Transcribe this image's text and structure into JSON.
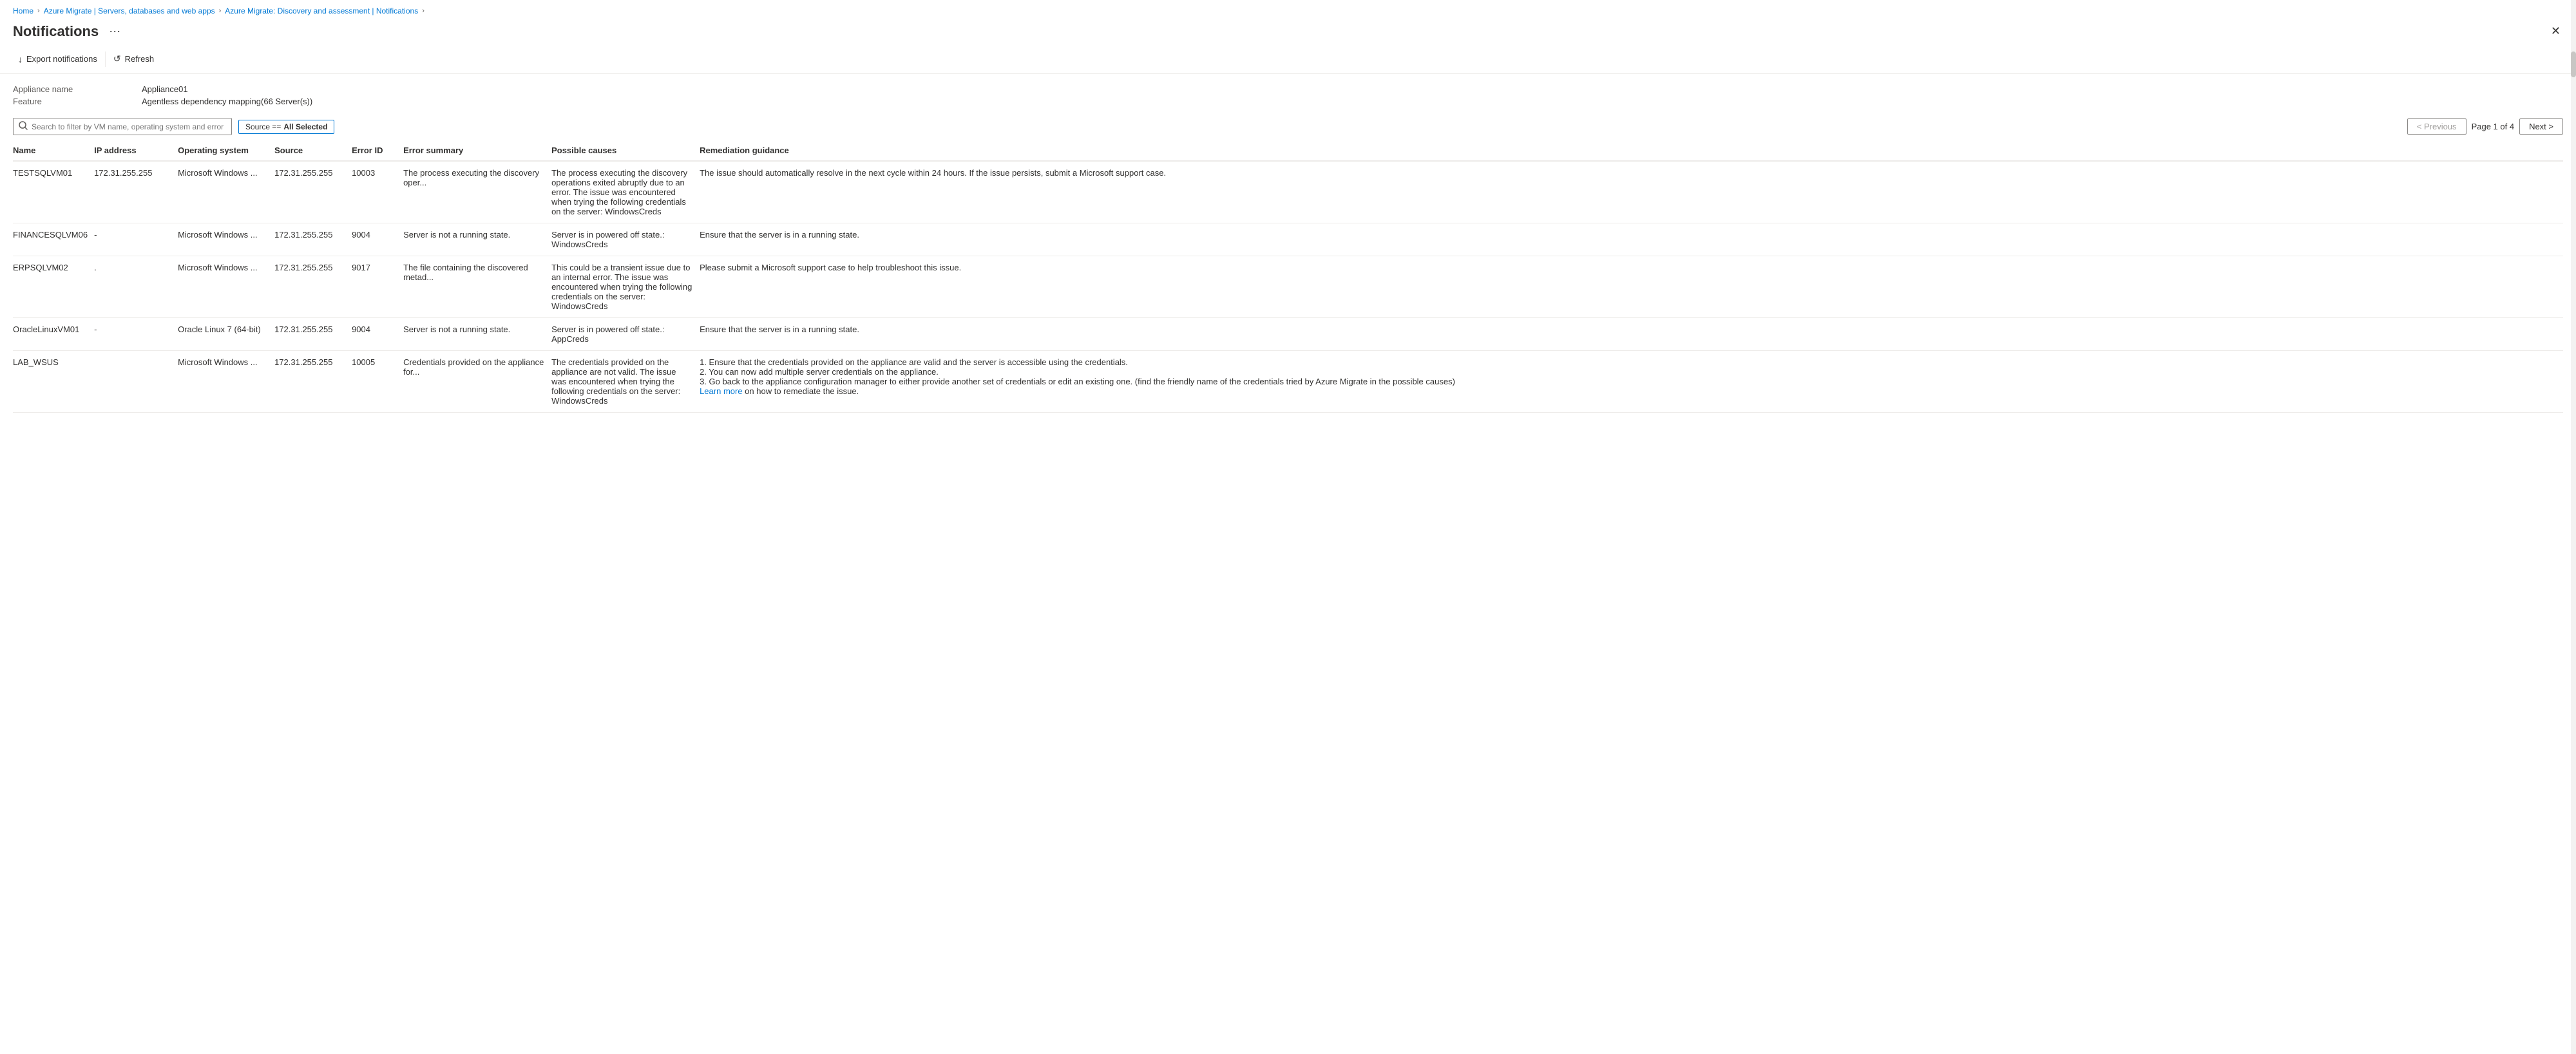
{
  "breadcrumb": {
    "items": [
      {
        "label": "Home",
        "href": "#"
      },
      {
        "label": "Azure Migrate | Servers, databases and web apps",
        "href": "#"
      },
      {
        "label": "Azure Migrate: Discovery and assessment | Notifications",
        "href": "#"
      }
    ]
  },
  "header": {
    "title": "Notifications",
    "more_label": "···",
    "close_label": "✕"
  },
  "toolbar": {
    "export_label": "Export notifications",
    "refresh_label": "Refresh"
  },
  "meta": {
    "appliance_name_label": "Appliance name",
    "appliance_name_value": "Appliance01",
    "feature_label": "Feature",
    "feature_value": "Agentless dependency mapping(66 Server(s))"
  },
  "filter": {
    "search_placeholder": "Search to filter by VM name, operating system and error ID",
    "tag_key": "Source ==",
    "tag_value": "All Selected"
  },
  "pagination": {
    "previous_label": "< Previous",
    "next_label": "Next >",
    "page_info": "Page 1 of 4"
  },
  "table": {
    "columns": [
      {
        "key": "name",
        "label": "Name"
      },
      {
        "key": "ip",
        "label": "IP address"
      },
      {
        "key": "os",
        "label": "Operating system"
      },
      {
        "key": "source",
        "label": "Source"
      },
      {
        "key": "error_id",
        "label": "Error ID"
      },
      {
        "key": "error_summary",
        "label": "Error summary"
      },
      {
        "key": "causes",
        "label": "Possible causes"
      },
      {
        "key": "remediation",
        "label": "Remediation guidance"
      }
    ],
    "rows": [
      {
        "name": "TESTSQLVM01",
        "ip": "172.31.255.255",
        "os": "Microsoft Windows ...",
        "source": "172.31.255.255",
        "error_id": "10003",
        "error_summary": "The process executing the discovery oper...",
        "causes": "The process executing the discovery operations exited abruptly due to an error. The issue was encountered when trying the following credentials on the server: WindowsCreds",
        "remediation": "The issue should automatically resolve in the next cycle within 24 hours. If the issue persists, submit a Microsoft support case.",
        "learn_more": null
      },
      {
        "name": "FINANCESQLVM06",
        "ip": "-",
        "os": "Microsoft Windows ...",
        "source": "172.31.255.255",
        "error_id": "9004",
        "error_summary": "Server is not a running state.",
        "causes": "Server is in powered off state.: WindowsCreds",
        "remediation": "Ensure that the server is in a running state.",
        "learn_more": null
      },
      {
        "name": "ERPSQLVM02",
        "ip": ".",
        "os": "Microsoft Windows ...",
        "source": "172.31.255.255",
        "error_id": "9017",
        "error_summary": "The file containing the discovered metad...",
        "causes": "This could be a transient issue due to an internal error. The issue was encountered when trying the following credentials on the server: WindowsCreds",
        "remediation": "Please submit a Microsoft support case to help troubleshoot this issue.",
        "learn_more": null
      },
      {
        "name": "OracleLinuxVM01",
        "ip": "-",
        "os": "Oracle Linux 7 (64-bit)",
        "source": "172.31.255.255",
        "error_id": "9004",
        "error_summary": "Server is not a running state.",
        "causes": "Server is in powered off state.: AppCreds",
        "remediation": "Ensure that the server is in a running state.",
        "learn_more": null
      },
      {
        "name": "LAB_WSUS",
        "ip": "",
        "os": "Microsoft Windows ...",
        "source": "172.31.255.255",
        "error_id": "10005",
        "error_summary": "Credentials provided on the appliance for...",
        "causes": "The credentials provided on the appliance are not valid. The issue was encountered when trying the following credentials on the server: WindowsCreds",
        "remediation": "1. Ensure that the credentials provided on the appliance are valid and the server is accessible using the credentials.\n2. You can now add multiple server credentials on the appliance.\n3. Go back to the appliance configuration manager to either provide another set of credentials or edit an existing one. (find the friendly name of the credentials tried by Azure Migrate in the possible causes)",
        "learn_more": "Learn more"
      }
    ]
  }
}
